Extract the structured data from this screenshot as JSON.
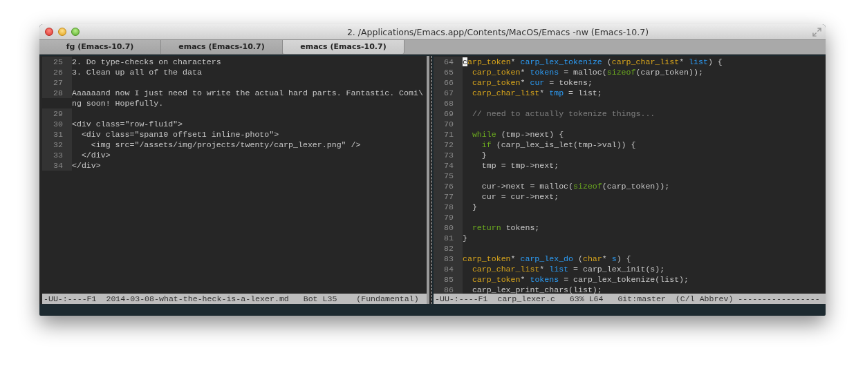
{
  "window": {
    "title": "2. /Applications/Emacs.app/Contents/MacOS/Emacs -nw  (Emacs-10.7)"
  },
  "tabs": [
    {
      "label": "fg (Emacs-10.7)",
      "selected": false
    },
    {
      "label": "emacs (Emacs-10.7)",
      "selected": false
    },
    {
      "label": "emacs (Emacs-10.7)",
      "selected": true
    }
  ],
  "left_pane": {
    "lines": [
      {
        "number": "25",
        "text": "2. Do type-checks on characters"
      },
      {
        "number": "26",
        "text": "3. Clean up all of the data"
      },
      {
        "number": "27"
      },
      {
        "number": "28",
        "text": "Aaaaaand now I just need to write the actual hard parts. Fantastic. Comi\\"
      },
      {
        "text": "ng soon! Hopefully."
      },
      {
        "number": "29"
      },
      {
        "number": "30",
        "text": "<div class=\"row-fluid\">"
      },
      {
        "number": "31",
        "text": "  <div class=\"span10 offset1 inline-photo\">"
      },
      {
        "number": "32",
        "text": "    <img src=\"/assets/img/projects/twenty/carp_lexer.png\" />"
      },
      {
        "number": "33",
        "text": "  </div>"
      },
      {
        "number": "34",
        "text": "</div>"
      }
    ],
    "mode_line": "-UU-:----F1  2014-03-08-what-the-heck-is-a-lexer.md   Bot L35    (Fundamental) "
  },
  "right_pane": {
    "lines": [
      {
        "number": "64",
        "tokens": [
          {
            "text": "c",
            "kind": "cursor"
          },
          {
            "text": "arp_token",
            "kind": "type"
          },
          {
            "text": "* ",
            "kind": "plain"
          },
          {
            "text": "carp_lex_tokenize",
            "kind": "func"
          },
          {
            "text": " (",
            "kind": "plain"
          },
          {
            "text": "carp_char_list",
            "kind": "type"
          },
          {
            "text": "* ",
            "kind": "plain"
          },
          {
            "text": "list",
            "kind": "func"
          },
          {
            "text": ") {",
            "kind": "plain"
          }
        ]
      },
      {
        "number": "65",
        "tokens": [
          {
            "text": "  carp_token",
            "kind": "type"
          },
          {
            "text": "* ",
            "kind": "plain"
          },
          {
            "text": "tokens",
            "kind": "func"
          },
          {
            "text": " = malloc(",
            "kind": "plain"
          },
          {
            "text": "sizeof",
            "kind": "keyword"
          },
          {
            "text": "(carp_token));",
            "kind": "plain"
          }
        ]
      },
      {
        "number": "66",
        "tokens": [
          {
            "text": "  carp_token",
            "kind": "type"
          },
          {
            "text": "* ",
            "kind": "plain"
          },
          {
            "text": "cur",
            "kind": "func"
          },
          {
            "text": " = tokens;",
            "kind": "plain"
          }
        ]
      },
      {
        "number": "67",
        "tokens": [
          {
            "text": "  carp_char_list",
            "kind": "type"
          },
          {
            "text": "* ",
            "kind": "plain"
          },
          {
            "text": "tmp",
            "kind": "func"
          },
          {
            "text": " = list;",
            "kind": "plain"
          }
        ]
      },
      {
        "number": "68"
      },
      {
        "number": "69",
        "tokens": [
          {
            "text": "  // need to actually tokenize things...",
            "kind": "comment"
          }
        ]
      },
      {
        "number": "70"
      },
      {
        "number": "71",
        "tokens": [
          {
            "text": "  while",
            "kind": "keyword"
          },
          {
            "text": " (tmp->next) {",
            "kind": "plain"
          }
        ]
      },
      {
        "number": "72",
        "tokens": [
          {
            "text": "    if",
            "kind": "keyword"
          },
          {
            "text": " (carp_lex_is_let(tmp->val)) {",
            "kind": "plain"
          }
        ]
      },
      {
        "number": "73",
        "tokens": [
          {
            "text": "    }",
            "kind": "plain"
          }
        ]
      },
      {
        "number": "74",
        "tokens": [
          {
            "text": "    tmp = tmp->next;",
            "kind": "plain"
          }
        ]
      },
      {
        "number": "75"
      },
      {
        "number": "76",
        "tokens": [
          {
            "text": "    cur->next = malloc(",
            "kind": "plain"
          },
          {
            "text": "sizeof",
            "kind": "keyword"
          },
          {
            "text": "(carp_token));",
            "kind": "plain"
          }
        ]
      },
      {
        "number": "77",
        "tokens": [
          {
            "text": "    cur = cur->next;",
            "kind": "plain"
          }
        ]
      },
      {
        "number": "78",
        "tokens": [
          {
            "text": "  }",
            "kind": "plain"
          }
        ]
      },
      {
        "number": "79"
      },
      {
        "number": "80",
        "tokens": [
          {
            "text": "  return",
            "kind": "keyword"
          },
          {
            "text": " tokens;",
            "kind": "plain"
          }
        ]
      },
      {
        "number": "81",
        "tokens": [
          {
            "text": "}",
            "kind": "plain"
          }
        ]
      },
      {
        "number": "82"
      },
      {
        "number": "83",
        "tokens": [
          {
            "text": "carp_token",
            "kind": "type"
          },
          {
            "text": "* ",
            "kind": "plain"
          },
          {
            "text": "carp_lex_do",
            "kind": "func"
          },
          {
            "text": " (",
            "kind": "plain"
          },
          {
            "text": "char",
            "kind": "type"
          },
          {
            "text": "* ",
            "kind": "plain"
          },
          {
            "text": "s",
            "kind": "func"
          },
          {
            "text": ") {",
            "kind": "plain"
          }
        ]
      },
      {
        "number": "84",
        "tokens": [
          {
            "text": "  carp_char_list",
            "kind": "type"
          },
          {
            "text": "* ",
            "kind": "plain"
          },
          {
            "text": "list",
            "kind": "func"
          },
          {
            "text": " = carp_lex_init(s);",
            "kind": "plain"
          }
        ]
      },
      {
        "number": "85",
        "tokens": [
          {
            "text": "  carp_token",
            "kind": "type"
          },
          {
            "text": "* ",
            "kind": "plain"
          },
          {
            "text": "tokens",
            "kind": "func"
          },
          {
            "text": " = carp_lex_tokenize(list);",
            "kind": "plain"
          }
        ]
      },
      {
        "number": "86",
        "tokens": [
          {
            "text": "  carp_lex_print_chars(list);",
            "kind": "plain"
          }
        ]
      }
    ],
    "mode_line": "-UU-:----F1  carp_lexer.c   63% L64   Git:master  (C/l Abbrev) -----------------"
  }
}
